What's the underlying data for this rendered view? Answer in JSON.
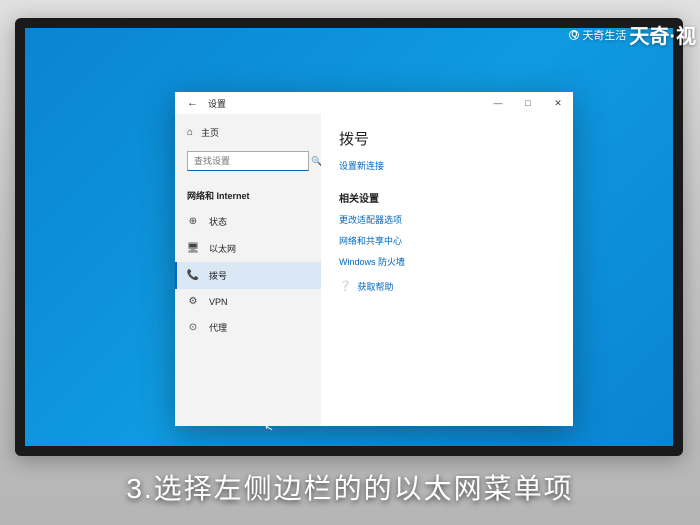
{
  "watermark": {
    "brand_small": "天奇生活",
    "brand_large": "天奇·视"
  },
  "window": {
    "title": "设置",
    "controls": {
      "min": "—",
      "max": "□",
      "close": "✕"
    }
  },
  "sidebar": {
    "home_label": "主页",
    "search_placeholder": "查找设置",
    "category": "网络和 Internet",
    "items": [
      {
        "icon": "⊕",
        "label": "状态"
      },
      {
        "icon": "󰀠",
        "label": "以太网"
      },
      {
        "icon": "⌨",
        "label": "拨号"
      },
      {
        "icon": "⚙",
        "label": "VPN"
      },
      {
        "icon": "⊙",
        "label": "代理"
      }
    ]
  },
  "content": {
    "title": "拨号",
    "new_connection": "设置新连接",
    "related_header": "相关设置",
    "links": [
      "更改适配器选项",
      "网络和共享中心",
      "Windows 防火墙"
    ],
    "help": "获取帮助"
  },
  "caption": "3.选择左侧边栏的的以太网菜单项"
}
